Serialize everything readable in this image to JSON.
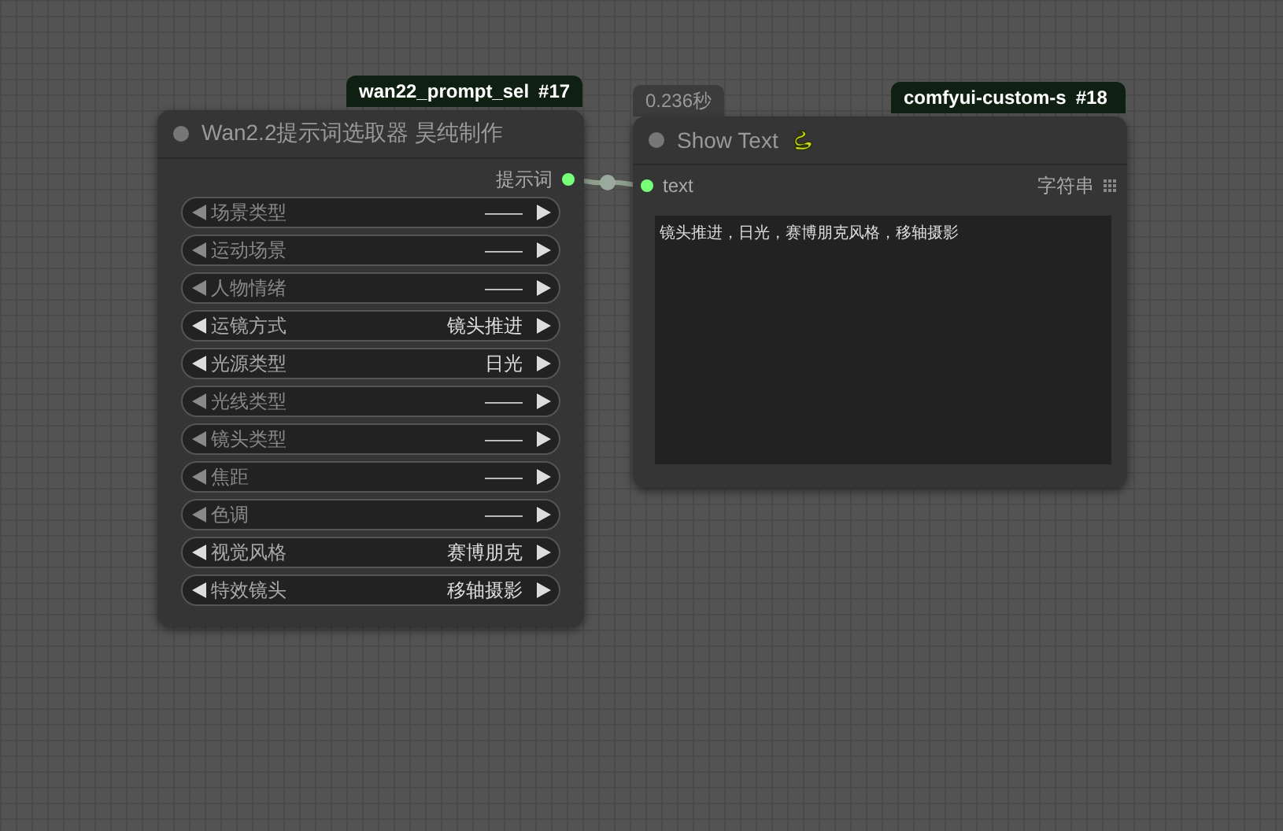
{
  "nodes": [
    {
      "kind": "selector",
      "badge": {
        "name": "wan22_prompt_sel",
        "id": "#17"
      },
      "title": "Wan2.2提示词选取器 昊纯制作",
      "output": "提示词",
      "widgets": [
        {
          "label": "场景类型",
          "value": "——",
          "dimmed": true
        },
        {
          "label": "运动场景",
          "value": "——",
          "dimmed": true
        },
        {
          "label": "人物情绪",
          "value": "——",
          "dimmed": true
        },
        {
          "label": "运镜方式",
          "value": "镜头推进",
          "dimmed": false
        },
        {
          "label": "光源类型",
          "value": "日光",
          "dimmed": false
        },
        {
          "label": "光线类型",
          "value": "——",
          "dimmed": true
        },
        {
          "label": "镜头类型",
          "value": "——",
          "dimmed": true
        },
        {
          "label": "焦距",
          "value": "——",
          "dimmed": true
        },
        {
          "label": "色调",
          "value": "——",
          "dimmed": true
        },
        {
          "label": "视觉风格",
          "value": "赛博朋克",
          "dimmed": false
        },
        {
          "label": "特效镜头",
          "value": "移轴摄影",
          "dimmed": false
        }
      ]
    },
    {
      "kind": "show_text",
      "timing": "0.236秒",
      "badge": {
        "name": "comfyui-custom-s",
        "id": "#18"
      },
      "title": "Show Text",
      "input": "text",
      "input_type": "字符串",
      "text": "镜头推进，日光，赛博朋克风格，移轴摄影"
    }
  ]
}
